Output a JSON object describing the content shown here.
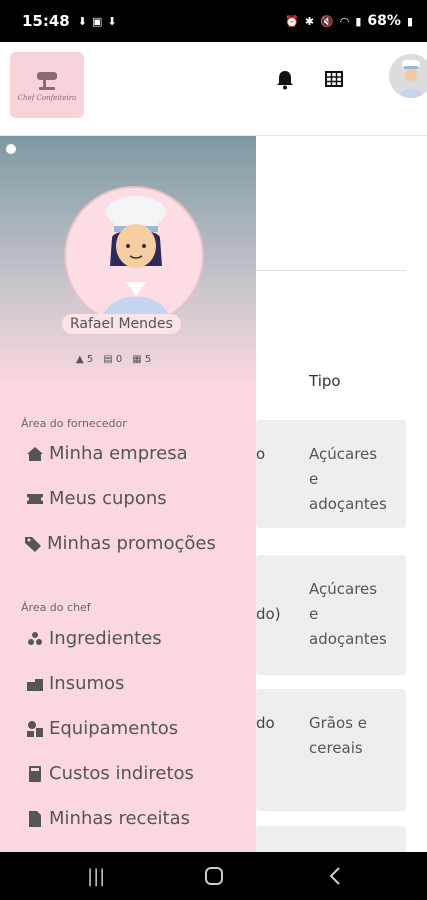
{
  "status_bar": {
    "time": "15:48",
    "left_icons": [
      "download-icon",
      "gallery-icon",
      "download-icon"
    ],
    "right_icons": [
      "alarm-icon",
      "bluetooth-icon",
      "mute-icon",
      "wifi-icon",
      "signal-icon"
    ],
    "battery": "68%"
  },
  "header": {
    "logo_text": "Chef Confeiteira",
    "icons": [
      "bell-icon",
      "grid-icon",
      "avatar"
    ]
  },
  "content": {
    "column_header": "Tipo",
    "rows": [
      {
        "partial": "o",
        "tipo": "Açúcares\ne\nadoçantes"
      },
      {
        "partial": "do)",
        "tipo": "Açúcares\ne\nadoçantes"
      },
      {
        "partial": "do",
        "tipo": "Grãos e\ncereais"
      }
    ]
  },
  "drawer": {
    "user_name": "Rafael Mendes",
    "counts": {
      "ingredients": "5",
      "costs": "0",
      "recipes": "5"
    },
    "supplier_section": "Área do fornecedor",
    "supplier_items": [
      "Minha empresa",
      "Meus cupons",
      "Minhas promoções"
    ],
    "chef_section": "Área do chef",
    "chef_items": [
      "Ingredientes",
      "Insumos",
      "Equipamentos",
      "Custos indiretos",
      "Minhas receitas"
    ]
  },
  "colors": {
    "drawer_pink": "#fbd8df",
    "drawer_top": "#7e9aa2",
    "row_grey": "#eeeeee"
  }
}
